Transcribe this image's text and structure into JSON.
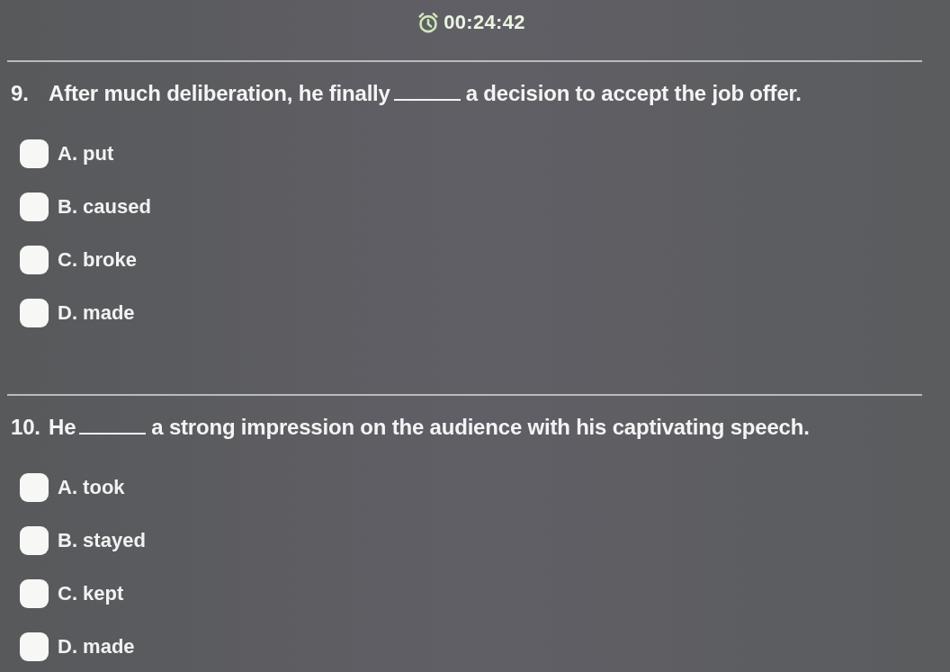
{
  "timer": {
    "time": "00:24:42"
  },
  "questions": [
    {
      "number": "9.",
      "text_before": "After much deliberation, he finally",
      "text_after": "a decision to accept the job offer.",
      "options": [
        {
          "label": "A. put",
          "checked": false
        },
        {
          "label": "B. caused",
          "checked": false
        },
        {
          "label": "C. broke",
          "checked": false
        },
        {
          "label": "D. made",
          "checked": false
        }
      ]
    },
    {
      "number": "10.",
      "text_before": "He",
      "text_after": "a strong impression on the audience with his captivating speech.",
      "options": [
        {
          "label": "A. took",
          "checked": false
        },
        {
          "label": "B. stayed",
          "checked": false
        },
        {
          "label": "C. kept",
          "checked": false
        },
        {
          "label": "D. made",
          "checked": false
        }
      ]
    }
  ]
}
